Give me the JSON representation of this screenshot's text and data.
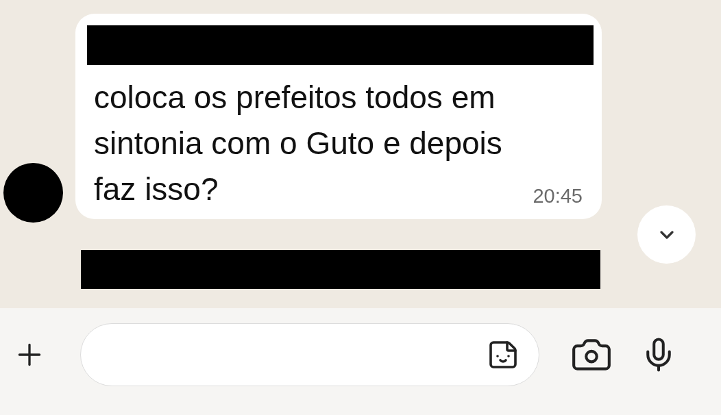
{
  "messages": [
    {
      "sender_redacted": true,
      "avatar_redacted": true,
      "text": "coloca os prefeitos todos em sintonia com o Guto e depois faz isso?",
      "time": "20:45"
    }
  ],
  "next_message": {
    "redacted": true
  }
}
